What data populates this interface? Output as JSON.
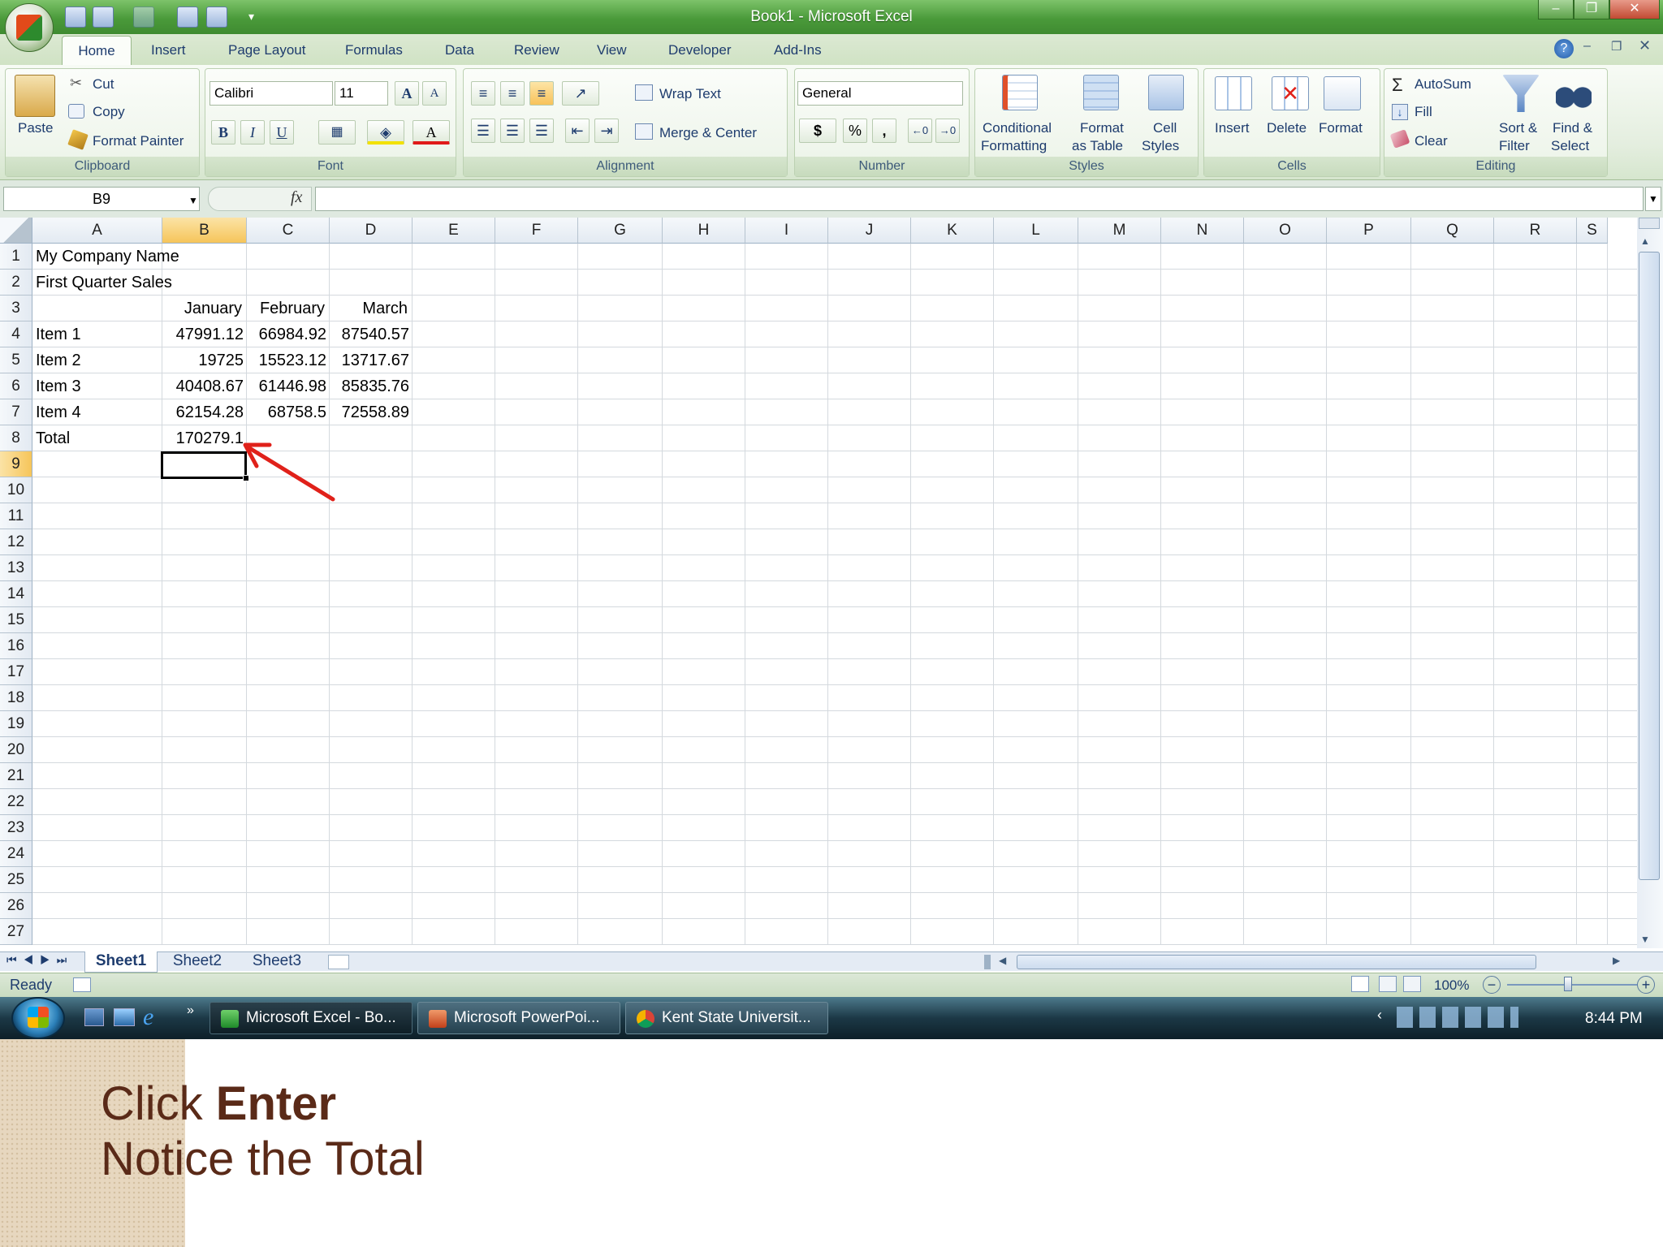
{
  "window": {
    "title": "Book1 - Microsoft Excel"
  },
  "ribbon_tabs": [
    "Home",
    "Insert",
    "Page Layout",
    "Formulas",
    "Data",
    "Review",
    "View",
    "Developer",
    "Add-Ins"
  ],
  "clipboard": {
    "paste": "Paste",
    "cut": "Cut",
    "copy": "Copy",
    "format_painter": "Format Painter",
    "group": "Clipboard"
  },
  "font": {
    "name": "Calibri",
    "size": "11",
    "bold": "B",
    "italic": "I",
    "underline": "U",
    "grow": "A",
    "shrink": "A",
    "color": "A",
    "group": "Font"
  },
  "alignment": {
    "wrap": "Wrap Text",
    "merge": "Merge & Center",
    "group": "Alignment"
  },
  "number": {
    "format": "General",
    "currency": "$",
    "percent": "%",
    "comma": ",",
    "group": "Number"
  },
  "styles": {
    "conditional_1": "Conditional",
    "conditional_2": "Formatting",
    "table_1": "Format",
    "table_2": "as Table",
    "cell_1": "Cell",
    "cell_2": "Styles",
    "group": "Styles"
  },
  "cells": {
    "insert": "Insert",
    "delete": "Delete",
    "format": "Format",
    "group": "Cells"
  },
  "editing": {
    "autosum": "AutoSum",
    "fill": "Fill",
    "clear": "Clear",
    "sort_1": "Sort &",
    "sort_2": "Filter",
    "find_1": "Find &",
    "find_2": "Select",
    "group": "Editing",
    "sigma": "Σ"
  },
  "formula_bar": {
    "name_box": "B9",
    "fx": "fx",
    "value": ""
  },
  "columns": [
    "A",
    "B",
    "C",
    "D",
    "E",
    "F",
    "G",
    "H",
    "I",
    "J",
    "K",
    "L",
    "M",
    "N",
    "O",
    "P",
    "Q",
    "R",
    "S"
  ],
  "rows": [
    "1",
    "2",
    "3",
    "4",
    "5",
    "6",
    "7",
    "8",
    "9",
    "10",
    "11",
    "12",
    "13",
    "14",
    "15",
    "16",
    "17",
    "18",
    "19",
    "20",
    "21",
    "22",
    "23",
    "24",
    "25",
    "26",
    "27"
  ],
  "sheet": {
    "A1": "My Company Name",
    "A2": "First Quarter Sales",
    "B3": "January",
    "C3": "February",
    "D3": "March",
    "A4": "Item 1",
    "B4": "47991.12",
    "C4": "66984.92",
    "D4": "87540.57",
    "A5": "Item 2",
    "B5": "19725",
    "C5": "15523.12",
    "D5": "13717.67",
    "A6": "Item 3",
    "B6": "40408.67",
    "C6": "61446.98",
    "D6": "85835.76",
    "A7": "Item 4",
    "B7": "62154.28",
    "C7": "68758.5",
    "D7": "72558.89",
    "A8": "Total",
    "B8": "170279.1"
  },
  "selected_cell": "B9",
  "sheet_tabs": [
    "Sheet1",
    "Sheet2",
    "Sheet3"
  ],
  "status": {
    "mode": "Ready",
    "zoom": "100%"
  },
  "taskbar": {
    "items": [
      "Microsoft Excel - Bo...",
      "Microsoft PowerPoi...",
      "Kent State Universit..."
    ],
    "clock": "8:44 PM",
    "overflow": "»"
  },
  "caption": {
    "line1_a": "Click ",
    "line1_b": "Enter",
    "line2": "Notice the Total"
  },
  "colors": {
    "accent": "#4a9a3a",
    "arrow": "#e0211a",
    "caption": "#5a2a18"
  }
}
